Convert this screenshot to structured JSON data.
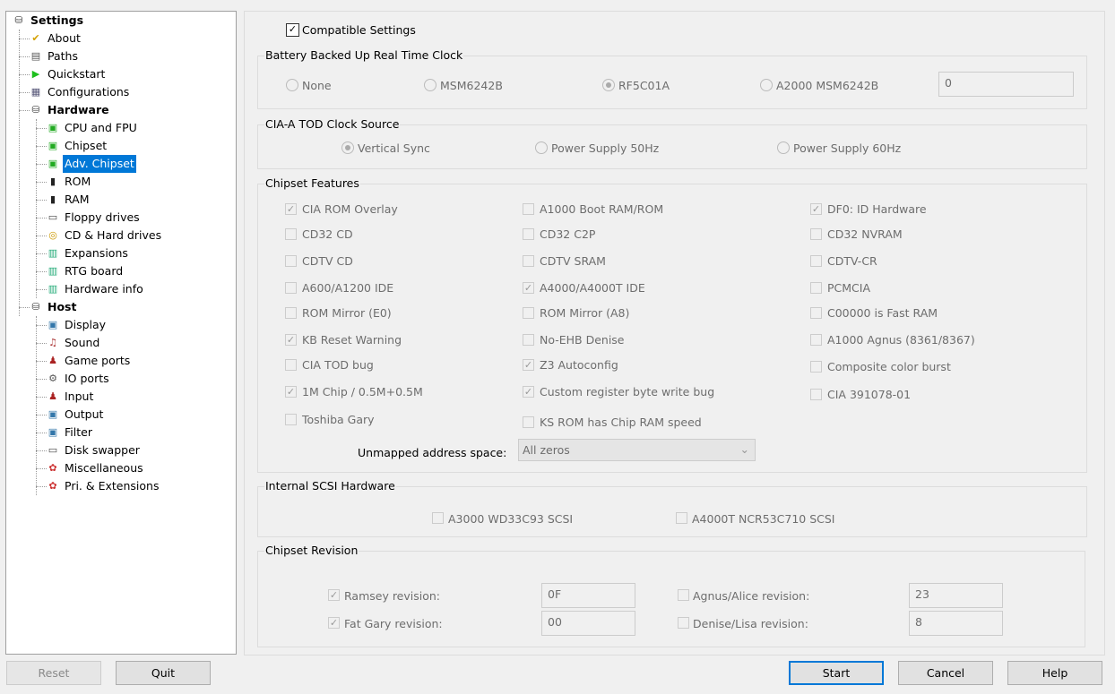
{
  "tree": {
    "items": [
      {
        "label": "Settings",
        "icon": "settings-icon",
        "level": 0,
        "bold": true
      },
      {
        "label": "About",
        "icon": "checkmark-icon",
        "level": 1
      },
      {
        "label": "Paths",
        "icon": "paths-icon",
        "level": 1
      },
      {
        "label": "Quickstart",
        "icon": "play-icon",
        "level": 1
      },
      {
        "label": "Configurations",
        "icon": "configurations-icon",
        "level": 1
      },
      {
        "label": "Hardware",
        "icon": "hardware-icon",
        "level": 1,
        "bold": true
      },
      {
        "label": "CPU and FPU",
        "icon": "chip-icon",
        "level": 2
      },
      {
        "label": "Chipset",
        "icon": "chip-icon",
        "level": 2
      },
      {
        "label": "Adv. Chipset",
        "icon": "chip-icon",
        "level": 2,
        "selected": true
      },
      {
        "label": "ROM",
        "icon": "memory-icon",
        "level": 2
      },
      {
        "label": "RAM",
        "icon": "memory-icon",
        "level": 2
      },
      {
        "label": "Floppy drives",
        "icon": "floppy-icon",
        "level": 2
      },
      {
        "label": "CD & Hard drives",
        "icon": "harddrive-icon",
        "level": 2
      },
      {
        "label": "Expansions",
        "icon": "expansion-card-icon",
        "level": 2
      },
      {
        "label": "RTG board",
        "icon": "expansion-card-icon",
        "level": 2
      },
      {
        "label": "Hardware info",
        "icon": "expansion-card-icon",
        "level": 2
      },
      {
        "label": "Host",
        "icon": "host-icon",
        "level": 1,
        "bold": true
      },
      {
        "label": "Display",
        "icon": "monitor-icon",
        "level": 2
      },
      {
        "label": "Sound",
        "icon": "sound-icon",
        "level": 2
      },
      {
        "label": "Game ports",
        "icon": "joystick-icon",
        "level": 2
      },
      {
        "label": "IO ports",
        "icon": "io-ports-icon",
        "level": 2
      },
      {
        "label": "Input",
        "icon": "joystick-icon",
        "level": 2
      },
      {
        "label": "Output",
        "icon": "monitor-icon",
        "level": 2
      },
      {
        "label": "Filter",
        "icon": "monitor-icon",
        "level": 2
      },
      {
        "label": "Disk swapper",
        "icon": "floppy-icon",
        "level": 2
      },
      {
        "label": "Miscellaneous",
        "icon": "misc-icon",
        "level": 2
      },
      {
        "label": "Pri. & Extensions",
        "icon": "misc-icon",
        "level": 2
      }
    ]
  },
  "compatible": {
    "label": "Compatible Settings",
    "checked": true
  },
  "rtc": {
    "title": "Battery Backed Up Real Time Clock",
    "options": [
      "None",
      "MSM6242B",
      "RF5C01A",
      "A2000 MSM6242B"
    ],
    "selected": "RF5C01A",
    "value": "0"
  },
  "tod": {
    "title": "CIA-A TOD Clock Source",
    "options": [
      "Vertical Sync",
      "Power Supply 50Hz",
      "Power Supply 60Hz"
    ],
    "selected": "Vertical Sync"
  },
  "features": {
    "title": "Chipset Features",
    "items": [
      {
        "label": "CIA ROM Overlay",
        "checked": true
      },
      {
        "label": "A1000 Boot RAM/ROM",
        "checked": false
      },
      {
        "label": "DF0: ID Hardware",
        "checked": true
      },
      {
        "label": "CD32 CD",
        "checked": false
      },
      {
        "label": "CD32 C2P",
        "checked": false
      },
      {
        "label": "CD32 NVRAM",
        "checked": false
      },
      {
        "label": "CDTV CD",
        "checked": false
      },
      {
        "label": "CDTV SRAM",
        "checked": false
      },
      {
        "label": "CDTV-CR",
        "checked": false
      },
      {
        "label": "A600/A1200 IDE",
        "checked": false
      },
      {
        "label": "A4000/A4000T IDE",
        "checked": true
      },
      {
        "label": "PCMCIA",
        "checked": false
      },
      {
        "label": "ROM Mirror (E0)",
        "checked": false
      },
      {
        "label": "ROM Mirror (A8)",
        "checked": false
      },
      {
        "label": "C00000 is Fast RAM",
        "checked": false
      },
      {
        "label": "KB Reset Warning",
        "checked": true
      },
      {
        "label": "No-EHB Denise",
        "checked": false
      },
      {
        "label": "A1000 Agnus (8361/8367)",
        "checked": false
      },
      {
        "label": "CIA TOD bug",
        "checked": false
      },
      {
        "label": "Z3 Autoconfig",
        "checked": true
      },
      {
        "label": "Composite color burst",
        "checked": false
      },
      {
        "label": "1M Chip / 0.5M+0.5M",
        "checked": true
      },
      {
        "label": "Custom register byte write bug",
        "checked": true
      },
      {
        "label": "CIA 391078-01",
        "checked": false
      },
      {
        "label": "Toshiba Gary",
        "checked": false
      },
      {
        "label": "KS ROM has Chip RAM speed",
        "checked": false
      }
    ],
    "unmapped_label": "Unmapped address space:",
    "unmapped_value": "All zeros"
  },
  "scsi": {
    "title": "Internal SCSI Hardware",
    "items": [
      {
        "label": "A3000 WD33C93 SCSI",
        "checked": false
      },
      {
        "label": "A4000T NCR53C710 SCSI",
        "checked": false
      }
    ]
  },
  "revision": {
    "title": "Chipset Revision",
    "items": [
      {
        "label": "Ramsey revision:",
        "checked": true,
        "value": "0F"
      },
      {
        "label": "Fat Gary revision:",
        "checked": true,
        "value": "00"
      },
      {
        "label": "Agnus/Alice revision:",
        "checked": false,
        "value": "23"
      },
      {
        "label": "Denise/Lisa revision:",
        "checked": false,
        "value": "8"
      }
    ]
  },
  "buttons": {
    "reset": "Reset",
    "quit": "Quit",
    "start": "Start",
    "cancel": "Cancel",
    "help": "Help"
  }
}
